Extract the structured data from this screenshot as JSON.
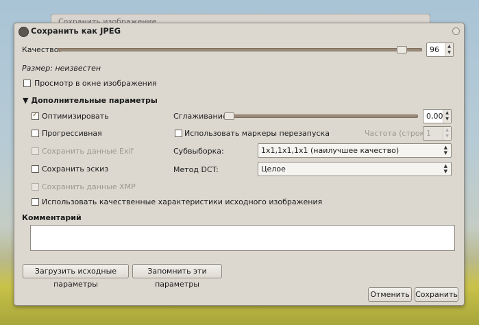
{
  "background_window": {
    "title": "Сохранить изображение"
  },
  "dialog": {
    "title": "Сохранить как JPEG",
    "quality": {
      "label": "Качество:",
      "value": "96",
      "fraction": 0.96
    },
    "size_text": "Размер: неизвестен",
    "preview_label": "Просмотр в окне изображения",
    "advanced": {
      "header": "Дополнительные параметры",
      "optimize": "Оптимизировать",
      "progressive": "Прогрессивная",
      "save_exif": "Сохранить данные Exif",
      "save_thumbnail": "Сохранить эскиз",
      "save_xmp": "Сохранить данные XMP",
      "use_quality": "Использовать качественные характеристики исходного изображения",
      "smoothing": {
        "label": "Сглаживание:",
        "value": "0,00",
        "fraction": 0.0
      },
      "restart_markers": "Использовать маркеры перезапуска",
      "frequency": {
        "label": "Частота (строки):",
        "value": "1"
      },
      "subsampling": {
        "label": "Субвыборка:",
        "value": "1x1,1x1,1x1 (наилучшее качество)"
      },
      "dct": {
        "label": "Метод DCT:",
        "value": "Целое"
      }
    },
    "comment_label": "Комментарий",
    "comment_value": "",
    "buttons": {
      "load_defaults": "Загрузить исходные параметры",
      "save_defaults": "Запомнить эти параметры",
      "cancel": "Отменить",
      "save": "Сохранить"
    }
  }
}
